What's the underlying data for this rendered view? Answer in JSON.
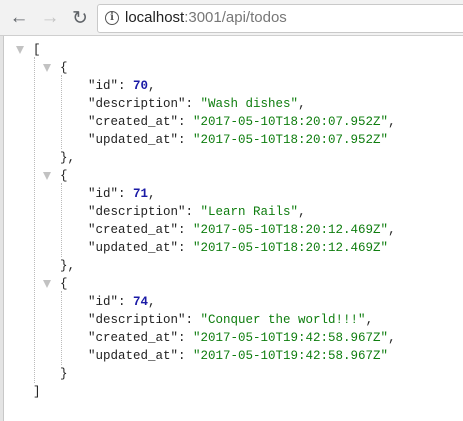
{
  "browser": {
    "url_host": "localhost",
    "url_rest": ":3001/api/todos",
    "icons": [
      "back-arrow-icon",
      "forward-arrow-icon",
      "reload-icon",
      "info-icon"
    ]
  },
  "todos": [
    {
      "id": "70",
      "description": "\"Wash dishes\"",
      "created_at": "\"2017-05-10T18:20:07.952Z\"",
      "updated_at": "\"2017-05-10T18:20:07.952Z\""
    },
    {
      "id": "71",
      "description": "\"Learn Rails\"",
      "created_at": "\"2017-05-10T18:20:12.469Z\"",
      "updated_at": "\"2017-05-10T18:20:12.469Z\""
    },
    {
      "id": "74",
      "description": "\"Conquer the world!!!\"",
      "created_at": "\"2017-05-10T19:42:58.967Z\"",
      "updated_at": "\"2017-05-10T19:42:58.967Z\""
    }
  ],
  "keys": {
    "id": "\"id\": ",
    "description": "\"description\": ",
    "created_at": "\"created_at\": ",
    "updated_at": "\"updated_at\": "
  },
  "punct": {
    "open_array": "[",
    "close_array": "]",
    "open_obj": "{",
    "close_obj_comma": "},",
    "close_obj": "}",
    "comma": ","
  }
}
